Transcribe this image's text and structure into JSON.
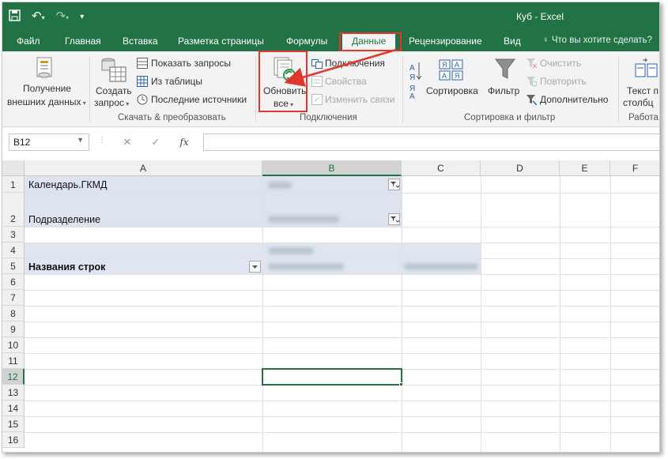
{
  "window": {
    "title": "Куб - Excel",
    "accent": "#217346",
    "highlight_color": "#e0362c"
  },
  "quick_access": {
    "save_icon": "save-icon",
    "undo_icon": "undo-icon",
    "redo_icon": "redo-icon",
    "customize_icon": "customize-icon"
  },
  "tabs": [
    {
      "label": "Файл"
    },
    {
      "label": "Главная"
    },
    {
      "label": "Вставка"
    },
    {
      "label": "Разметка страницы"
    },
    {
      "label": "Формулы"
    },
    {
      "label": "Данные",
      "active": true
    },
    {
      "label": "Рецензирование"
    },
    {
      "label": "Вид"
    }
  ],
  "tell_me": "Что вы хотите сделать?",
  "ribbon": {
    "get_external_line1": "Получение",
    "get_external_line2": "внешних данных",
    "new_query_line1": "Создать",
    "new_query_line2": "запрос",
    "show_queries": "Показать запросы",
    "from_table": "Из таблицы",
    "recent_sources": "Последние источники",
    "group_get_transform": "Скачать & преобразовать",
    "refresh_all_line1": "Обновить",
    "refresh_all_line2": "все",
    "connections": "Подключения",
    "properties": "Свойства",
    "edit_links": "Изменить связи",
    "group_connections": "Подключения",
    "sort": "Сортировка",
    "filter": "Фильтр",
    "clear": "Очистить",
    "reapply": "Повторить",
    "advanced": "Дополнительно",
    "group_sort_filter": "Сортировка и фильтр",
    "text_to_columns_line1": "Текст п",
    "text_to_columns_line2": "столбц",
    "group_data_tools": "Работа"
  },
  "formula_bar": {
    "name_box": "B12",
    "cancel_symbol": "✕",
    "enter_symbol": "✓",
    "fx_label": "fx",
    "formula": ""
  },
  "columns": [
    "A",
    "B",
    "C",
    "D",
    "E",
    "F"
  ],
  "rows": [
    "1",
    "2",
    "3",
    "4",
    "5",
    "6",
    "7",
    "8",
    "9",
    "10",
    "11",
    "12",
    "13",
    "14",
    "15",
    "16"
  ],
  "cells": {
    "a1": "Календарь.ГКМД",
    "a2": "Подразделение",
    "a5": "Названия строк"
  },
  "selected_cell": "B12"
}
